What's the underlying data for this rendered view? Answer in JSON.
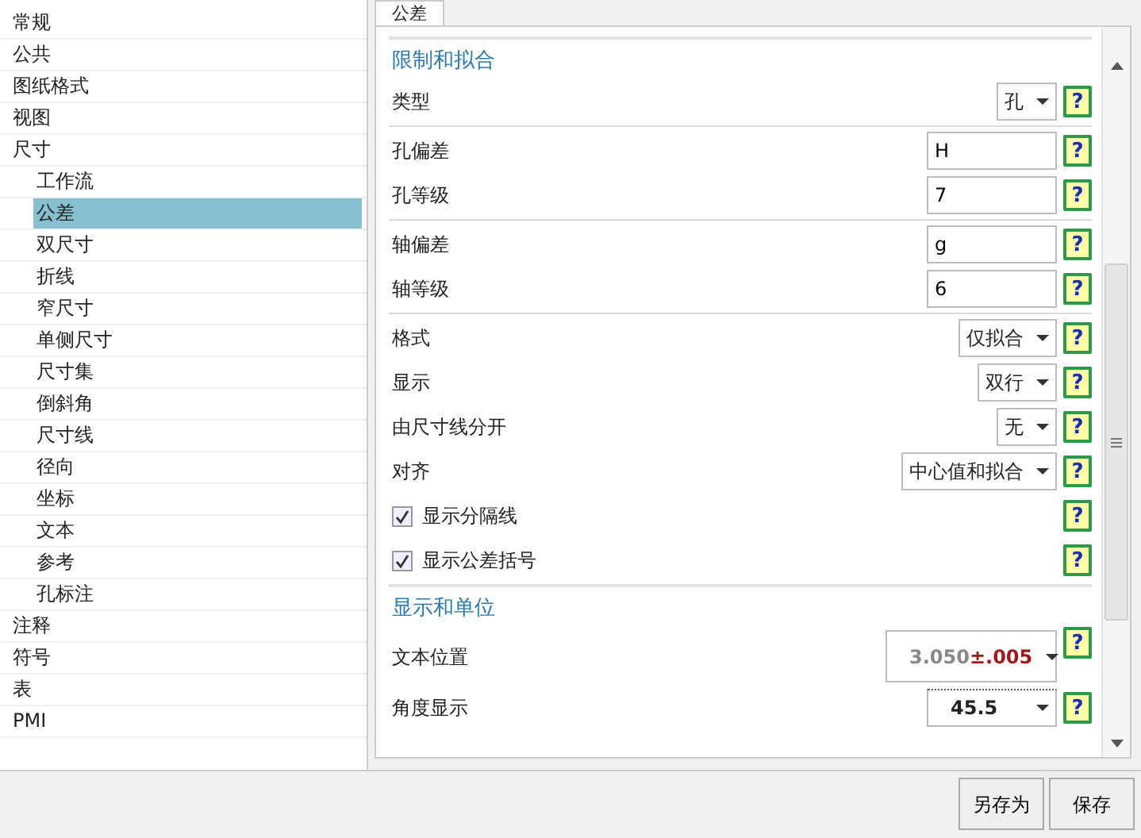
{
  "tree": [
    {
      "label": "常规",
      "selected": false
    },
    {
      "label": "公共",
      "selected": false
    },
    {
      "label": "图纸格式",
      "selected": false
    },
    {
      "label": "视图",
      "selected": false
    },
    {
      "label": "尺寸",
      "selected": false,
      "children": [
        {
          "label": "工作流",
          "selected": false
        },
        {
          "label": "公差",
          "selected": true
        },
        {
          "label": "双尺寸",
          "selected": false
        },
        {
          "label": "折线",
          "selected": false
        },
        {
          "label": "窄尺寸",
          "selected": false
        },
        {
          "label": "单侧尺寸",
          "selected": false
        },
        {
          "label": "尺寸集",
          "selected": false
        },
        {
          "label": "倒斜角",
          "selected": false
        },
        {
          "label": "尺寸线",
          "selected": false
        },
        {
          "label": "径向",
          "selected": false
        },
        {
          "label": "坐标",
          "selected": false
        },
        {
          "label": "文本",
          "selected": false
        },
        {
          "label": "参考",
          "selected": false
        },
        {
          "label": "孔标注",
          "selected": false
        }
      ]
    },
    {
      "label": "注释",
      "selected": false
    },
    {
      "label": "符号",
      "selected": false
    },
    {
      "label": "表",
      "selected": false
    },
    {
      "label": "PMI",
      "selected": false
    }
  ],
  "tabs": [
    {
      "label": "公差",
      "selected": true
    }
  ],
  "sections": [
    {
      "title": "限制和拟合",
      "groups": [
        [
          {
            "kind": "dropdown",
            "label": "类型",
            "value": "孔",
            "help": "?"
          }
        ],
        [
          {
            "kind": "text",
            "label": "孔偏差",
            "value": "H",
            "help": "?"
          },
          {
            "kind": "text",
            "label": "孔等级",
            "value": "7",
            "help": "?"
          }
        ],
        [
          {
            "kind": "text",
            "label": "轴偏差",
            "value": "g",
            "help": "?"
          },
          {
            "kind": "text",
            "label": "轴等级",
            "value": "6",
            "help": "?"
          }
        ],
        [
          {
            "kind": "dropdown",
            "label": "格式",
            "value": "仅拟合",
            "help": "?"
          },
          {
            "kind": "dropdown",
            "label": "显示",
            "value": "双行",
            "help": "?"
          },
          {
            "kind": "dropdown",
            "label": "由尺寸线分开",
            "value": "无",
            "help": "?"
          },
          {
            "kind": "dropdown",
            "label": "对齐",
            "value": "中心值和拟合",
            "help": "?"
          },
          {
            "kind": "checkbox",
            "label": "显示分隔线",
            "checked": true,
            "help": "?"
          },
          {
            "kind": "checkbox",
            "label": "显示公差括号",
            "checked": true,
            "help": "?"
          }
        ]
      ]
    },
    {
      "title": "显示和单位",
      "groups": [
        [
          {
            "kind": "preview",
            "label": "文本位置",
            "value": "3.050",
            "tolerance": "±.005",
            "help": "?"
          },
          {
            "kind": "angle",
            "label": "角度显示",
            "value": "45.5",
            "help": "?"
          }
        ]
      ]
    }
  ],
  "buttons": [
    "另存为",
    "保存"
  ]
}
